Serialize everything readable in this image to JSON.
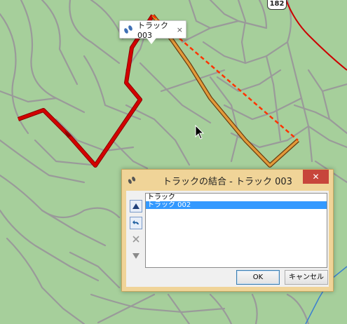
{
  "map": {
    "road_number": "182",
    "colors": {
      "background": "#a6cf9b",
      "road": "#999999",
      "track": "#cc0000",
      "active_track": "#d08a2a",
      "join_line": "#ff3300"
    }
  },
  "tooltip": {
    "icon": "footsteps-icon",
    "label": "トラック 003",
    "close": "×"
  },
  "dialog": {
    "title": "トラックの結合 - トラック 003",
    "close": "✕",
    "tools": [
      "move-up-icon",
      "undo-icon",
      "delete-icon",
      "move-down-icon"
    ],
    "list": [
      "トラック",
      "トラック 002"
    ],
    "selected_index": 1,
    "ok": "OK",
    "cancel": "キャンセル"
  }
}
